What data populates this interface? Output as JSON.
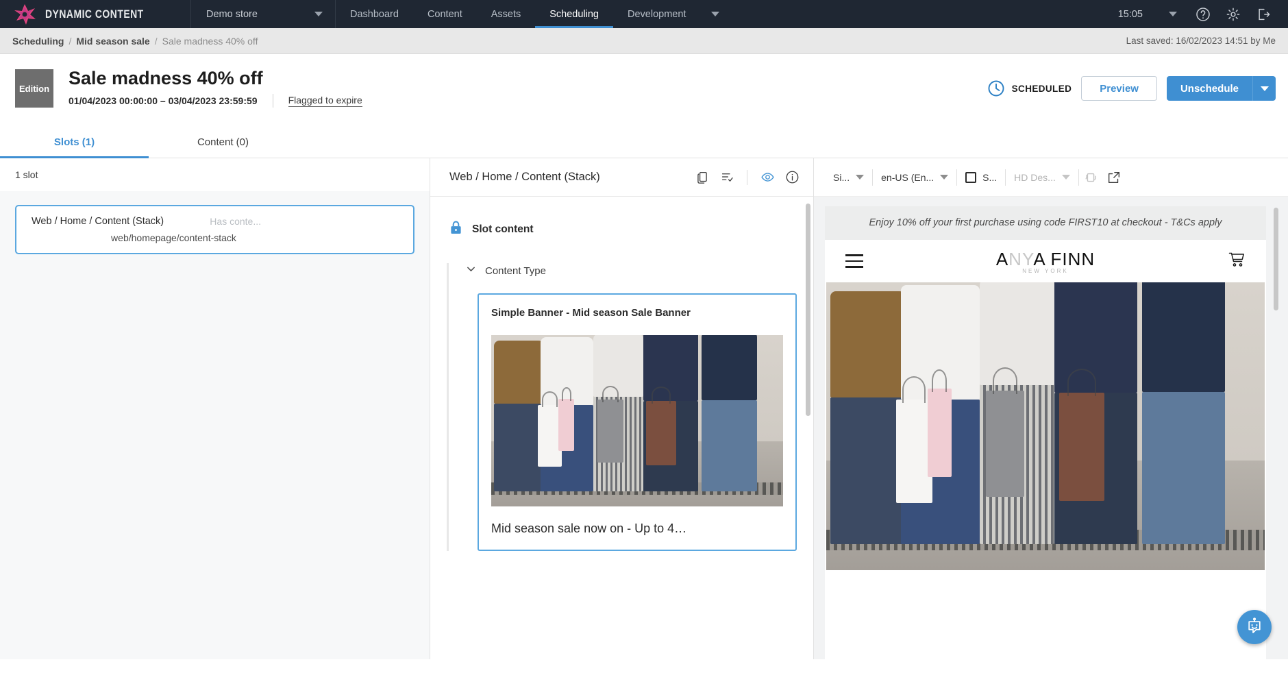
{
  "topnav": {
    "brand": "DYNAMIC CONTENT",
    "store_selector": "Demo store",
    "links": [
      {
        "label": "Dashboard",
        "active": false
      },
      {
        "label": "Content",
        "active": false
      },
      {
        "label": "Assets",
        "active": false
      },
      {
        "label": "Scheduling",
        "active": true
      },
      {
        "label": "Development",
        "active": false
      }
    ],
    "more_label": "",
    "clock": "15:05",
    "icons": [
      "help-icon",
      "gear-icon",
      "logout-icon"
    ]
  },
  "breadcrumb": {
    "items": [
      "Scheduling",
      "Mid season sale",
      "Sale madness 40% off"
    ],
    "separator": "/",
    "last_saved": "Last saved: 16/02/2023 14:51 by Me"
  },
  "title_area": {
    "badge": "Edition",
    "title": "Sale madness 40% off",
    "date_range": "01/04/2023 00:00:00  –  03/04/2023 23:59:59",
    "flagged": "Flagged to expire",
    "status": "SCHEDULED",
    "status_icon": "clock-icon",
    "preview_button": "Preview",
    "unschedule_button": "Unschedule"
  },
  "tabs": [
    {
      "label": "Slots (1)",
      "active": true
    },
    {
      "label": "Content (0)",
      "active": false
    }
  ],
  "left_panel": {
    "count_label": "1 slot",
    "slot": {
      "name": "Web / Home / Content (Stack)",
      "status": "Has conte...",
      "path": "web/homepage/content-stack"
    }
  },
  "mid_panel": {
    "header_title": "Web / Home / Content (Stack)",
    "header_icons": [
      "copy-icon",
      "list-check-icon",
      "visibility-eye-icon",
      "info-icon"
    ],
    "slot_content_label": "Slot content",
    "slot_content_icon": "lock-icon",
    "content_type_label": "Content Type",
    "content_type_icon": "chevron-down-icon",
    "card": {
      "title": "Simple Banner - Mid season Sale Banner",
      "caption": "Mid season sale now on - Up to 4…"
    }
  },
  "preview_panel": {
    "toolbar": {
      "size_select": "Si...",
      "locale_select": "en-US (En...",
      "checkbox_label": "S...",
      "device_select": "HD Des...",
      "rotate_icon": "rotate-device-icon",
      "open_external_icon": "open-external-icon"
    },
    "promo_text": "Enjoy 10% off your first purchase using code FIRST10 at checkout - T&Cs apply",
    "store": {
      "menu_icon": "hamburger-menu-icon",
      "logo_main": "ANYA FINN",
      "logo_a1": "A",
      "logo_n": "N",
      "logo_y": "Y",
      "logo_rest": "A FINN",
      "logo_sub": "NEW YORK",
      "cart_icon": "shopping-cart-icon"
    },
    "chatbot_icon": "chatbot-icon"
  },
  "colors": {
    "accent": "#3f8fd2",
    "navbar": "#1f2733",
    "breadcrumb_bg": "#e8e8e8",
    "selection_border": "#5ba8e0"
  }
}
